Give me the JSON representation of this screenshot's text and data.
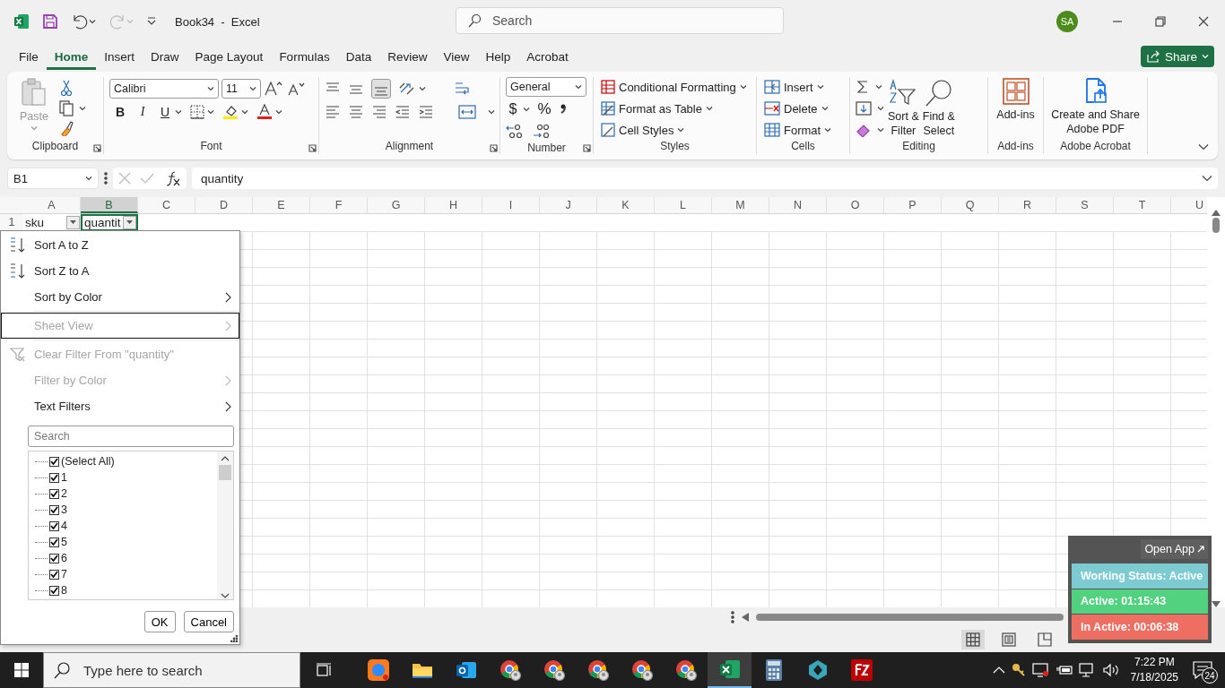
{
  "title_bar": {
    "title": "Book34  -  Excel",
    "search_placeholder": "Search",
    "avatar": "SA",
    "redo_disabled": true
  },
  "menu_tabs": [
    {
      "label": "File",
      "selected": false
    },
    {
      "label": "Home",
      "selected": true
    },
    {
      "label": "Insert",
      "selected": false
    },
    {
      "label": "Draw",
      "selected": false
    },
    {
      "label": "Page Layout",
      "selected": false
    },
    {
      "label": "Formulas",
      "selected": false
    },
    {
      "label": "Data",
      "selected": false
    },
    {
      "label": "Review",
      "selected": false
    },
    {
      "label": "View",
      "selected": false
    },
    {
      "label": "Help",
      "selected": false
    },
    {
      "label": "Acrobat",
      "selected": false
    }
  ],
  "share_label": "Share",
  "ribbon": [
    {
      "kind": "clipboard",
      "label": "Clipboard",
      "paste": "Paste"
    },
    {
      "kind": "font",
      "label": "Font",
      "font_name": "Calibri",
      "font_size": "11",
      "bold": "B",
      "italic": "I",
      "underline": "U"
    },
    {
      "kind": "alignment",
      "label": "Alignment"
    },
    {
      "kind": "number",
      "label": "Number",
      "format": "General",
      "currency": "$",
      "percent": "%"
    },
    {
      "kind": "styles",
      "label": "Styles",
      "buttons": [
        "Conditional Formatting",
        "Format as Table",
        "Cell Styles"
      ]
    },
    {
      "kind": "cells",
      "label": "Cells",
      "buttons": [
        "Insert",
        "Delete",
        "Format"
      ]
    },
    {
      "kind": "editing",
      "label": "Editing",
      "sort_filter": "Sort &\nFilter",
      "find_select": "Find &\nSelect"
    },
    {
      "kind": "addins",
      "label": "Add-ins",
      "button": "Add-ins"
    },
    {
      "kind": "acrobat",
      "label": "Adobe Acrobat",
      "button": "Create and Share\nAdobe PDF"
    }
  ],
  "formula_bar": {
    "name_box": "B1",
    "formula": "quantity"
  },
  "sheet": {
    "columns": [
      {
        "label": "A",
        "selected": false
      },
      {
        "label": "B",
        "selected": true
      },
      {
        "label": "C",
        "selected": false
      },
      {
        "label": "D",
        "selected": false
      },
      {
        "label": "E",
        "selected": false
      },
      {
        "label": "F",
        "selected": false
      },
      {
        "label": "G",
        "selected": false
      },
      {
        "label": "H",
        "selected": false
      },
      {
        "label": "I",
        "selected": false
      },
      {
        "label": "J",
        "selected": false
      },
      {
        "label": "K",
        "selected": false
      },
      {
        "label": "L",
        "selected": false
      },
      {
        "label": "M",
        "selected": false
      },
      {
        "label": "N",
        "selected": false
      },
      {
        "label": "O",
        "selected": false
      },
      {
        "label": "P",
        "selected": false
      },
      {
        "label": "Q",
        "selected": false
      },
      {
        "label": "R",
        "selected": false
      },
      {
        "label": "S",
        "selected": false
      },
      {
        "label": "T",
        "selected": false
      },
      {
        "label": "U",
        "selected": false
      }
    ],
    "rows": [
      {
        "label": "1",
        "cells": [
          {
            "text": "sku",
            "filter": true,
            "selected": false
          },
          {
            "text": "quantit",
            "filter": true,
            "selected": true
          }
        ]
      }
    ]
  },
  "filter_menu": {
    "items": [
      {
        "label": "Sort A to Z",
        "kind": "sort-asc",
        "disabled": false,
        "submenu": false,
        "selected": false
      },
      {
        "label": "Sort Z to A",
        "kind": "sort-desc",
        "disabled": false,
        "submenu": false,
        "selected": false
      },
      {
        "label": "Sort by Color",
        "kind": "plain",
        "disabled": false,
        "submenu": true,
        "selected": false
      },
      {
        "label": "Sheet View",
        "kind": "plain",
        "disabled": true,
        "submenu": true,
        "selected": true
      },
      {
        "label": "Clear Filter From \"quantity\"",
        "kind": "clear-filter",
        "disabled": true,
        "submenu": false,
        "selected": false
      },
      {
        "label": "Filter by Color",
        "kind": "plain",
        "disabled": true,
        "submenu": true,
        "selected": false
      },
      {
        "label": "Text Filters",
        "kind": "plain",
        "disabled": false,
        "submenu": true,
        "selected": false
      }
    ],
    "search_placeholder": "Search",
    "values": [
      {
        "label": "(Select All)",
        "checked": true
      },
      {
        "label": "1",
        "checked": true
      },
      {
        "label": "2",
        "checked": true
      },
      {
        "label": "3",
        "checked": true
      },
      {
        "label": "4",
        "checked": true
      },
      {
        "label": "5",
        "checked": true
      },
      {
        "label": "6",
        "checked": true
      },
      {
        "label": "7",
        "checked": true
      },
      {
        "label": "8",
        "checked": true
      }
    ],
    "buttons": [
      "OK",
      "Cancel"
    ]
  },
  "status_bar": {
    "views": [
      {
        "kind": "normal",
        "selected": true
      },
      {
        "kind": "page-layout",
        "selected": false
      },
      {
        "kind": "page-break",
        "selected": false
      }
    ]
  },
  "time_tracker": {
    "open_app": "Open App",
    "rows": [
      {
        "text": "Working Status: Active",
        "color": "#7ccad2"
      },
      {
        "text": "Active: 01:15:43",
        "color": "#52d17f"
      },
      {
        "text": "In Active: 00:06:38",
        "color": "#ee6e61"
      }
    ]
  },
  "taskbar": {
    "search_placeholder": "Type here to search",
    "apps": [
      {
        "kind": "zoom",
        "selected": false
      },
      {
        "kind": "explorer",
        "selected": false
      },
      {
        "kind": "outlook",
        "selected": false
      },
      {
        "kind": "chrome",
        "selected": false
      },
      {
        "kind": "chrome",
        "selected": false
      },
      {
        "kind": "chrome",
        "selected": false
      },
      {
        "kind": "chrome",
        "selected": false
      },
      {
        "kind": "chrome",
        "selected": false
      },
      {
        "kind": "excel",
        "selected": true
      },
      {
        "kind": "calculator",
        "selected": false
      },
      {
        "kind": "gem",
        "selected": false
      },
      {
        "kind": "filezilla",
        "selected": false
      }
    ],
    "time": "7:22 PM",
    "date": "7/18/2025",
    "notifications": "24"
  }
}
